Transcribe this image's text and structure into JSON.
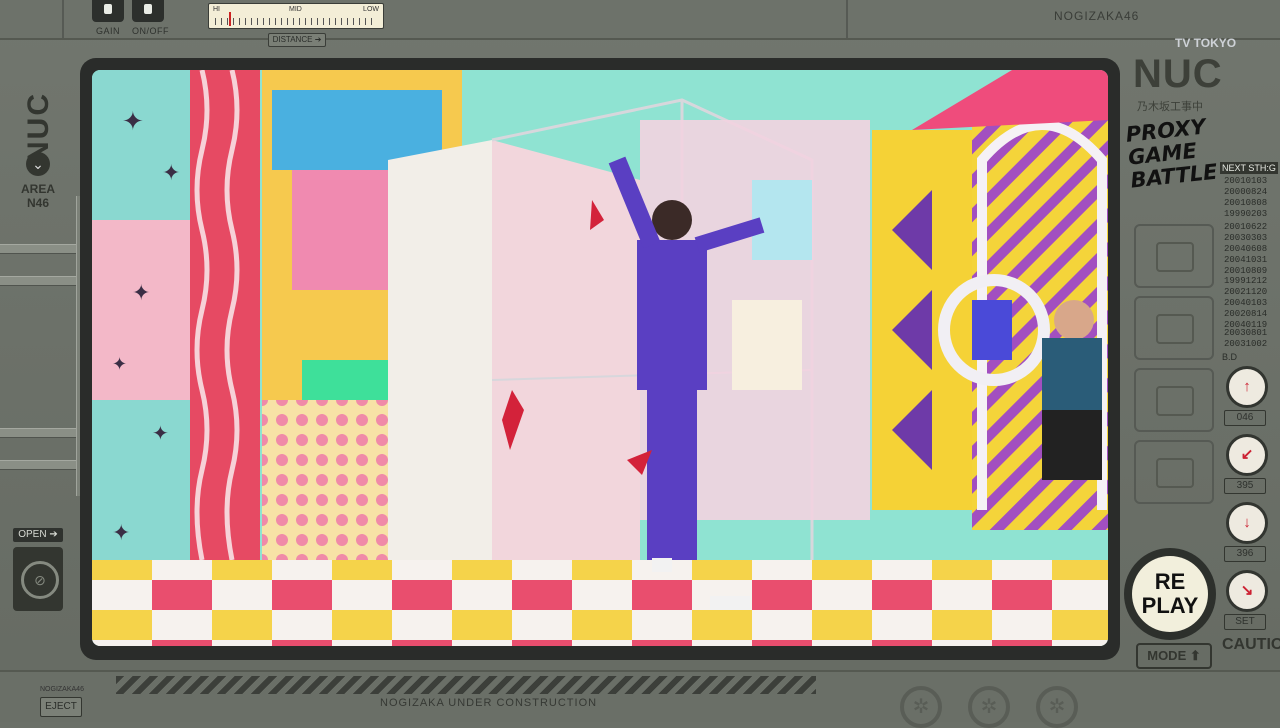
{
  "top": {
    "gain_label": "GAIN",
    "onoff_label": "ON/OFF",
    "meter_hi": "HI",
    "meter_mid": "MID",
    "meter_low": "LOW",
    "distance_label": "DISTANCE",
    "distance_icon": "arrow-circle-icon",
    "right_label": "NOGIZAKA46"
  },
  "left": {
    "nuc": "NUC",
    "area_line1": "AREA",
    "area_line2": "N46",
    "open_label": "OPEN",
    "open_icon": "disc-icon"
  },
  "right": {
    "tv_logo": "TV TOKYO",
    "nuc_big": "NUC",
    "jp_label": "乃木坂工事中",
    "proxy_line1": "PROXY",
    "proxy_line2": "GAME",
    "proxy_line3": "BATTLE",
    "next_label": "NEXT STH:G",
    "dates_group1": [
      "20010103",
      "20000824",
      "20010808",
      "19990203"
    ],
    "dates_group2": [
      "20010622",
      "20030303",
      "20040608",
      "20041031",
      "20010809"
    ],
    "dates_group3": [
      "19991212",
      "20021120",
      "20040103",
      "20020814",
      "20040119"
    ],
    "dates_group4": [
      "20030801",
      "20031002"
    ],
    "bd_label": "B.D",
    "gauge_labels": [
      "046",
      "395",
      "396",
      "SET"
    ],
    "replay_line1": "RE",
    "replay_line2": "PLAY",
    "mode_label": "MODE",
    "caution_label": "CAUTION"
  },
  "bottom": {
    "eject_label": "EJECT",
    "eject_small": "NOGIZAKA46",
    "under_construction": "NOGIZAKA UNDER CONSTRUCTION"
  },
  "colors": {
    "frame": "#6b7068",
    "bezel": "#2a2c2a",
    "sky": "#8fe3d2",
    "pink": "#f3b8c8",
    "purple": "#5a3fc2",
    "yellow": "#f5d236"
  }
}
